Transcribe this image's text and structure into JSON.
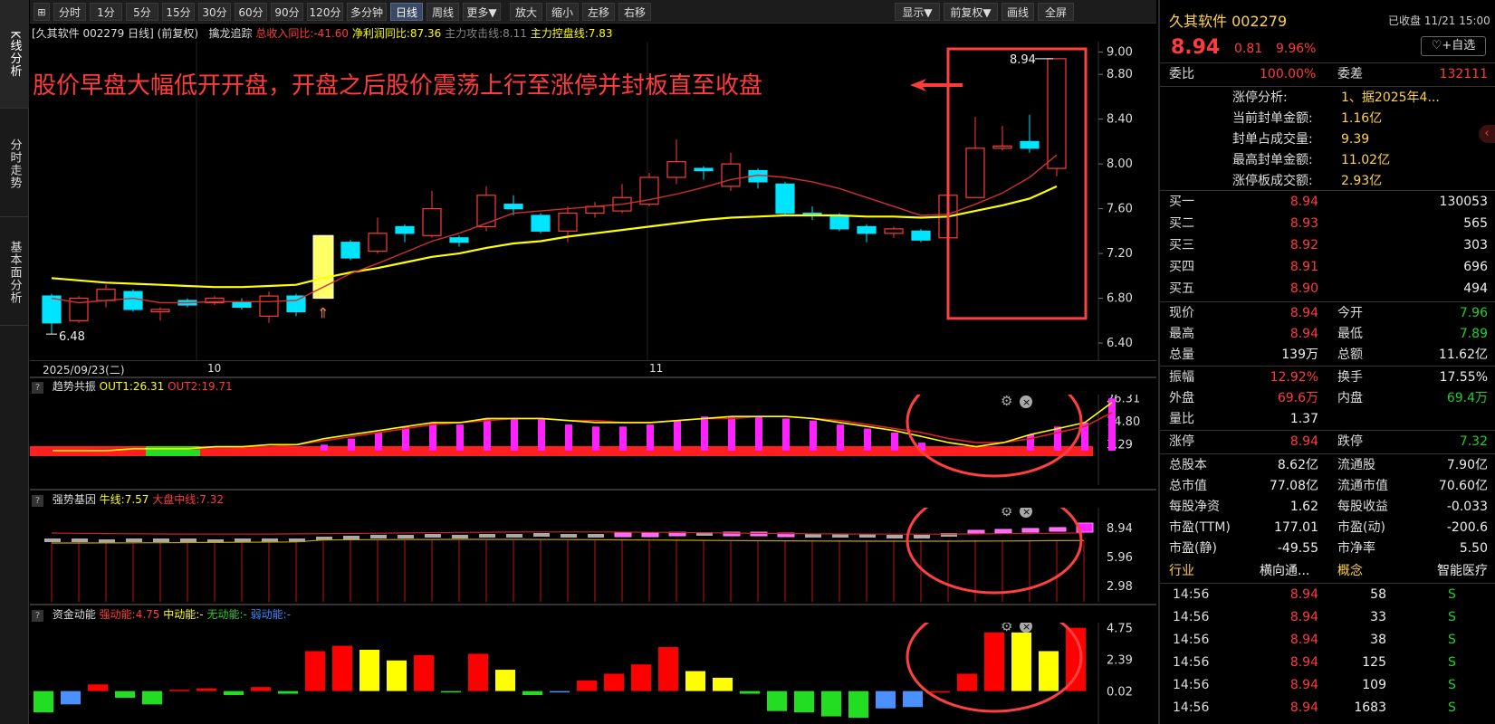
{
  "left_tabs": [
    {
      "label": "K线分析",
      "active": true
    },
    {
      "label": "分时走势",
      "active": false
    },
    {
      "label": "基本面分析",
      "active": false
    }
  ],
  "toolbar": {
    "periods": [
      "分时",
      "1分",
      "5分",
      "15分",
      "30分",
      "60分",
      "90分",
      "120分",
      "多分钟",
      "日线",
      "周线",
      "更多▼"
    ],
    "active_period": "日线",
    "actions": [
      "放大",
      "缩小",
      "左移",
      "右移"
    ],
    "right_actions": [
      "显示▼",
      "前复权▼",
      "画线",
      "全屏"
    ]
  },
  "main_info": {
    "title": "[久其软件 002279 日线]",
    "adjust": "(前复权)",
    "indicator": "擒龙追踪",
    "item1": "总收入同比:-41.60",
    "item2": "净利润同比:87.36",
    "item3": "主力攻击线:8.11",
    "item4": "主力控盘线:7.83"
  },
  "annotation": "股价早盘大幅低开开盘，开盘之后股价震荡上行至涨停并封板直至收盘",
  "main_chart": {
    "y_ticks": [
      "9.00",
      "8.80",
      "8.40",
      "8.00",
      "7.60",
      "7.20",
      "6.80",
      "6.40"
    ],
    "high_label": "8.94",
    "low_label": "6.48",
    "date_label": "2025/09/23(二)",
    "month_labels": [
      "10",
      "11"
    ]
  },
  "chart_data": {
    "type": "candlestick",
    "colors": {
      "up": "#ff3b3b",
      "down": "#00e5ff",
      "ma_slow": "#ffff00",
      "ma_fast": "#d03030"
    },
    "candles": [
      {
        "o": 6.82,
        "h": 6.84,
        "c": 6.58,
        "l": 6.48
      },
      {
        "o": 6.6,
        "h": 6.82,
        "c": 6.8,
        "l": 6.58
      },
      {
        "o": 6.78,
        "h": 6.92,
        "c": 6.88,
        "l": 6.72
      },
      {
        "o": 6.86,
        "h": 6.88,
        "c": 6.7,
        "l": 6.68
      },
      {
        "o": 6.68,
        "h": 6.72,
        "c": 6.7,
        "l": 6.6
      },
      {
        "o": 6.78,
        "h": 6.8,
        "c": 6.74,
        "l": 6.72
      },
      {
        "o": 6.76,
        "h": 6.82,
        "c": 6.8,
        "l": 6.74
      },
      {
        "o": 6.76,
        "h": 6.8,
        "c": 6.72,
        "l": 6.7
      },
      {
        "o": 6.64,
        "h": 6.86,
        "c": 6.82,
        "l": 6.58
      },
      {
        "o": 6.82,
        "h": 6.84,
        "c": 6.68,
        "l": 6.64
      },
      {
        "o": 6.8,
        "h": 7.36,
        "c": 7.36,
        "l": 6.8
      },
      {
        "o": 7.3,
        "h": 7.32,
        "c": 7.16,
        "l": 7.14
      },
      {
        "o": 7.22,
        "h": 7.52,
        "c": 7.38,
        "l": 7.2
      },
      {
        "o": 7.44,
        "h": 7.46,
        "c": 7.38,
        "l": 7.3
      },
      {
        "o": 7.36,
        "h": 7.76,
        "c": 7.6,
        "l": 7.34
      },
      {
        "o": 7.34,
        "h": 7.36,
        "c": 7.3,
        "l": 7.26
      },
      {
        "o": 7.44,
        "h": 7.8,
        "c": 7.72,
        "l": 7.4
      },
      {
        "o": 7.64,
        "h": 7.72,
        "c": 7.6,
        "l": 7.54
      },
      {
        "o": 7.54,
        "h": 7.56,
        "c": 7.4,
        "l": 7.38
      },
      {
        "o": 7.4,
        "h": 7.62,
        "c": 7.56,
        "l": 7.3
      },
      {
        "o": 7.56,
        "h": 7.66,
        "c": 7.62,
        "l": 7.52
      },
      {
        "o": 7.58,
        "h": 7.82,
        "c": 7.7,
        "l": 7.56
      },
      {
        "o": 7.64,
        "h": 7.92,
        "c": 7.88,
        "l": 7.62
      },
      {
        "o": 7.88,
        "h": 8.22,
        "c": 8.02,
        "l": 7.82
      },
      {
        "o": 7.96,
        "h": 7.98,
        "c": 7.94,
        "l": 7.86
      },
      {
        "o": 7.8,
        "h": 8.1,
        "c": 8.0,
        "l": 7.76
      },
      {
        "o": 7.94,
        "h": 7.96,
        "c": 7.84,
        "l": 7.78
      },
      {
        "o": 7.82,
        "h": 7.84,
        "c": 7.56,
        "l": 7.54
      },
      {
        "o": 7.56,
        "h": 7.62,
        "c": 7.54,
        "l": 7.5
      },
      {
        "o": 7.54,
        "h": 7.56,
        "c": 7.42,
        "l": 7.4
      },
      {
        "o": 7.44,
        "h": 7.46,
        "c": 7.38,
        "l": 7.3
      },
      {
        "o": 7.38,
        "h": 7.44,
        "c": 7.42,
        "l": 7.34
      },
      {
        "o": 7.4,
        "h": 7.42,
        "c": 7.32,
        "l": 7.3
      },
      {
        "o": 7.34,
        "h": 7.9,
        "c": 7.72,
        "l": 7.32
      },
      {
        "o": 7.7,
        "h": 8.42,
        "c": 8.14,
        "l": 7.7
      },
      {
        "o": 8.14,
        "h": 8.34,
        "c": 8.16,
        "l": 8.12
      },
      {
        "o": 8.2,
        "h": 8.44,
        "c": 8.14,
        "l": 8.1
      },
      {
        "o": 7.96,
        "h": 8.94,
        "c": 8.94,
        "l": 7.89
      }
    ],
    "ma_slow": [
      6.98,
      6.96,
      6.94,
      6.93,
      6.92,
      6.91,
      6.9,
      6.9,
      6.91,
      6.92,
      6.98,
      7.03,
      7.07,
      7.12,
      7.17,
      7.2,
      7.25,
      7.29,
      7.31,
      7.35,
      7.38,
      7.41,
      7.44,
      7.47,
      7.5,
      7.52,
      7.53,
      7.54,
      7.54,
      7.54,
      7.53,
      7.53,
      7.52,
      7.53,
      7.58,
      7.63,
      7.69,
      7.8
    ],
    "ma_fast": [
      6.8,
      6.76,
      6.78,
      6.8,
      6.76,
      6.76,
      6.77,
      6.77,
      6.77,
      6.78,
      6.9,
      7.02,
      7.11,
      7.21,
      7.31,
      7.38,
      7.47,
      7.56,
      7.58,
      7.6,
      7.62,
      7.64,
      7.68,
      7.73,
      7.79,
      7.86,
      7.9,
      7.88,
      7.84,
      7.78,
      7.7,
      7.62,
      7.54,
      7.55,
      7.64,
      7.74,
      7.88,
      8.08
    ]
  },
  "panel1": {
    "name": "趋势共振",
    "out1": "OUT1:26.31",
    "out2": "OUT2:19.71",
    "y_ticks": [
      "26.31",
      "14.80",
      "3.29"
    ],
    "bars": [
      0,
      0,
      0,
      0,
      0,
      0,
      0,
      0,
      0,
      0,
      3,
      6,
      9,
      12,
      14,
      13,
      16,
      16,
      16,
      13,
      12,
      12,
      13,
      15,
      17,
      17,
      17,
      16,
      15,
      13,
      11,
      9,
      4,
      0,
      0,
      0,
      8,
      12,
      14,
      26
    ],
    "band_colors": [
      "r",
      "r",
      "r",
      "r",
      "g",
      "g",
      "r",
      "r",
      "r",
      "r",
      "r",
      "r",
      "r",
      "r",
      "r",
      "r",
      "r",
      "r",
      "r",
      "r",
      "r",
      "r",
      "r",
      "r",
      "r",
      "r",
      "r",
      "r",
      "r",
      "r",
      "r",
      "r",
      "r",
      "r",
      "r",
      "r",
      "r",
      "r",
      "r"
    ],
    "line1": [
      0,
      0,
      0,
      1,
      1,
      1,
      2,
      2,
      3,
      3,
      6,
      8,
      10,
      12,
      14,
      14,
      16,
      16,
      16,
      15,
      14,
      14,
      14,
      15,
      16,
      17,
      17,
      17,
      16,
      14,
      12,
      10,
      7,
      4,
      2,
      4,
      8,
      11,
      14,
      24
    ],
    "line2": [
      0,
      0,
      1,
      1,
      1,
      1,
      1,
      2,
      2,
      3,
      5,
      7,
      9,
      11,
      13,
      14,
      15,
      16,
      16,
      15,
      15,
      14,
      14,
      15,
      16,
      16,
      17,
      17,
      16,
      15,
      13,
      11,
      9,
      6,
      4,
      4,
      6,
      9,
      12,
      19
    ]
  },
  "panel2": {
    "name": "强势基因",
    "l1": "牛线:7.57",
    "l2": "大盘中线:7.32",
    "y_ticks": [
      "8.94",
      "5.96",
      "2.98"
    ]
  },
  "panel3": {
    "name": "资金动能",
    "s1": "强动能:4.75",
    "s2": "中动能:-",
    "s3": "无动能:-",
    "s4": "弱动能:-",
    "y_ticks": [
      "4.75",
      "2.39",
      "0.02"
    ],
    "bars": [
      {
        "v": -1.6,
        "c": "g"
      },
      {
        "v": -1.0,
        "c": "b"
      },
      {
        "v": 0.5,
        "c": "r"
      },
      {
        "v": -0.5,
        "c": "g"
      },
      {
        "v": -1.0,
        "c": "g"
      },
      {
        "v": 0.1,
        "c": "r"
      },
      {
        "v": 0.2,
        "c": "r"
      },
      {
        "v": -0.3,
        "c": "g"
      },
      {
        "v": 0.3,
        "c": "r"
      },
      {
        "v": -0.2,
        "c": "g"
      },
      {
        "v": 3.0,
        "c": "r"
      },
      {
        "v": 3.4,
        "c": "r"
      },
      {
        "v": 3.1,
        "c": "y"
      },
      {
        "v": 2.3,
        "c": "y"
      },
      {
        "v": 2.7,
        "c": "r"
      },
      {
        "v": -0.1,
        "c": "g"
      },
      {
        "v": 2.8,
        "c": "r"
      },
      {
        "v": 1.6,
        "c": "y"
      },
      {
        "v": -0.3,
        "c": "g"
      },
      {
        "v": -0.1,
        "c": "b"
      },
      {
        "v": 0.8,
        "c": "r"
      },
      {
        "v": 1.3,
        "c": "r"
      },
      {
        "v": 2.0,
        "c": "r"
      },
      {
        "v": 3.3,
        "c": "r"
      },
      {
        "v": 1.5,
        "c": "y"
      },
      {
        "v": 1.0,
        "c": "y"
      },
      {
        "v": -0.2,
        "c": "g"
      },
      {
        "v": -1.5,
        "c": "g"
      },
      {
        "v": -1.6,
        "c": "g"
      },
      {
        "v": -1.9,
        "c": "g"
      },
      {
        "v": -2.0,
        "c": "g"
      },
      {
        "v": -1.3,
        "c": "b"
      },
      {
        "v": -1.2,
        "c": "b"
      },
      {
        "v": 0,
        "c": "r"
      },
      {
        "v": 1.3,
        "c": "r"
      },
      {
        "v": 4.4,
        "c": "r"
      },
      {
        "v": 4.4,
        "c": "y"
      },
      {
        "v": 3.0,
        "c": "y"
      },
      {
        "v": 4.75,
        "c": "r"
      }
    ]
  },
  "quote": {
    "name": "久其软件 002279",
    "status": "已收盘 11/21 15:00",
    "price": "8.94",
    "change": "0.81",
    "pct": "9.96%",
    "watch": "+自选",
    "weibi_l": "委比",
    "weibi": "100.00%",
    "weicha_l": "委差",
    "weicha": "132111",
    "limit": [
      {
        "k": "涨停分析:",
        "v": "1、据2025年4..."
      },
      {
        "k": "当前封单金额:",
        "v": "1.16亿"
      },
      {
        "k": "封单占成交量:",
        "v": "9.39"
      },
      {
        "k": "最高封单金额:",
        "v": "11.02亿"
      },
      {
        "k": "涨停板成交额:",
        "v": "2.93亿"
      }
    ],
    "bids": [
      {
        "k": "买一",
        "p": "8.94",
        "v": "130053"
      },
      {
        "k": "买二",
        "p": "8.93",
        "v": "565"
      },
      {
        "k": "买三",
        "p": "8.92",
        "v": "303"
      },
      {
        "k": "买四",
        "p": "8.91",
        "v": "696"
      },
      {
        "k": "买五",
        "p": "8.90",
        "v": "494"
      }
    ],
    "stats1": [
      {
        "k1": "现价",
        "v1": "8.94",
        "c1": "r",
        "k2": "今开",
        "v2": "7.96",
        "c2": "g"
      },
      {
        "k1": "最高",
        "v1": "8.94",
        "c1": "r",
        "k2": "最低",
        "v2": "7.89",
        "c2": "g"
      },
      {
        "k1": "总量",
        "v1": "139万",
        "c1": "w",
        "k2": "总额",
        "v2": "11.62亿",
        "c2": "w"
      }
    ],
    "stats2": [
      {
        "k1": "振幅",
        "v1": "12.92%",
        "c1": "r",
        "k2": "换手",
        "v2": "17.55%",
        "c2": "w"
      },
      {
        "k1": "外盘",
        "v1": "69.6万",
        "c1": "r",
        "k2": "内盘",
        "v2": "69.4万",
        "c2": "g"
      },
      {
        "k1": "量比",
        "v1": "1.37",
        "c1": "w",
        "k2": "",
        "v2": "",
        "c2": "w"
      }
    ],
    "limits": {
      "k1": "涨停",
      "v1": "8.94",
      "k2": "跌停",
      "v2": "7.32"
    },
    "stats3": [
      {
        "k1": "总股本",
        "v1": "8.62亿",
        "k2": "流通股",
        "v2": "7.90亿"
      },
      {
        "k1": "总市值",
        "v1": "77.08亿",
        "k2": "流通市值",
        "v2": "70.60亿"
      },
      {
        "k1": "每股净资",
        "v1": "1.62",
        "k2": "每股收益",
        "v2": "-0.033"
      },
      {
        "k1": "市盈(TTM)",
        "v1": "177.01",
        "k2": "市盈(动)",
        "v2": "-200.6"
      },
      {
        "k1": "市盈(静)",
        "v1": "-49.55",
        "k2": "市净率",
        "v2": "5.50"
      }
    ],
    "industry_l": "行业",
    "industry": "横向通...",
    "concept_l": "概念",
    "concept": "智能医疗",
    "ticks": [
      {
        "t": "14:56",
        "p": "8.94",
        "v": "58",
        "d": "S"
      },
      {
        "t": "14:56",
        "p": "8.94",
        "v": "33",
        "d": "S"
      },
      {
        "t": "14:56",
        "p": "8.94",
        "v": "38",
        "d": "S"
      },
      {
        "t": "14:56",
        "p": "8.94",
        "v": "125",
        "d": "S"
      },
      {
        "t": "14:56",
        "p": "8.94",
        "v": "109",
        "d": "S"
      },
      {
        "t": "14:56",
        "p": "8.94",
        "v": "1683",
        "d": "S"
      }
    ]
  }
}
